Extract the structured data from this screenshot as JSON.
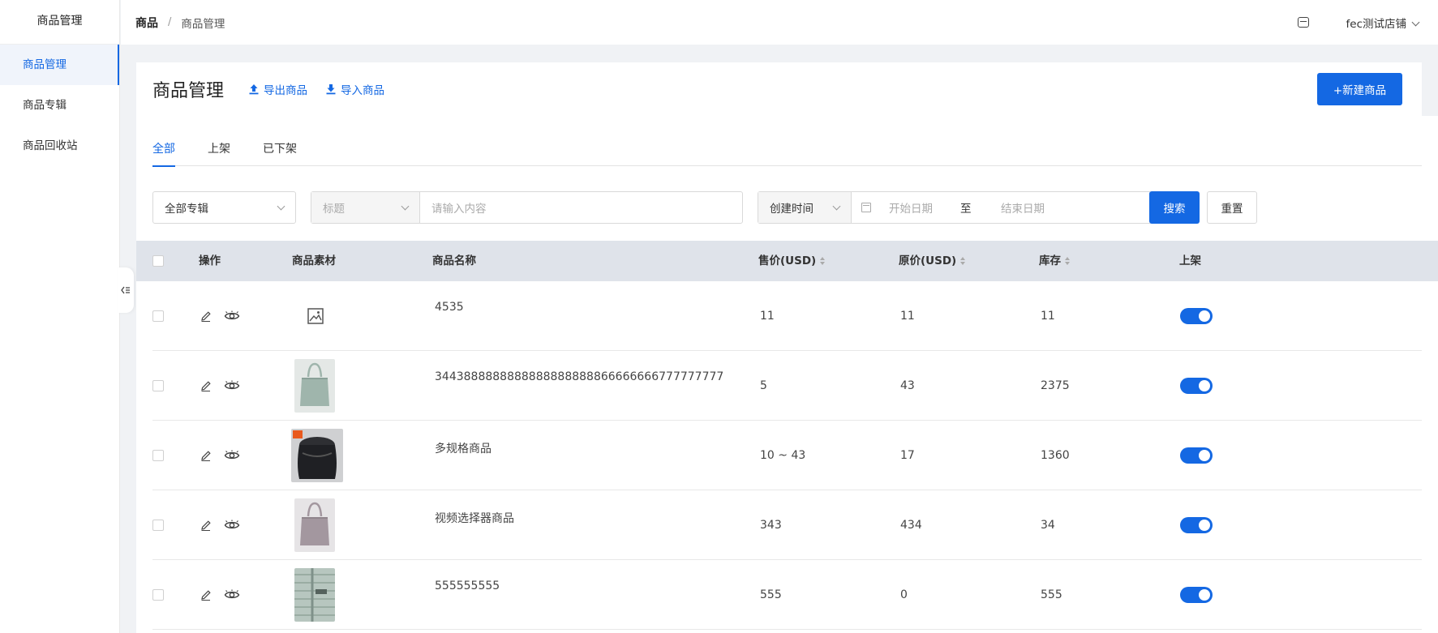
{
  "sidebar": {
    "title": "商品管理",
    "items": [
      {
        "label": "商品管理",
        "active": true
      },
      {
        "label": "商品专辑",
        "active": false
      },
      {
        "label": "商品回收站",
        "active": false
      }
    ]
  },
  "topbar": {
    "breadcrumb": [
      "商品",
      "商品管理"
    ],
    "separator": "/",
    "shop_name": "fec测试店铺"
  },
  "header": {
    "title": "商品管理",
    "export_label": "导出商品",
    "import_label": "导入商品",
    "new_button": "+新建商品"
  },
  "tabs": [
    {
      "label": "全部",
      "active": true
    },
    {
      "label": "上架",
      "active": false
    },
    {
      "label": "已下架",
      "active": false
    }
  ],
  "filters": {
    "album_select": "全部专辑",
    "field_select": "标题",
    "keyword_placeholder": "请输入内容",
    "time_select": "创建时间",
    "start_placeholder": "开始日期",
    "range_sep": "至",
    "end_placeholder": "结束日期",
    "search_button": "搜索",
    "reset_button": "重置"
  },
  "table": {
    "columns": [
      "操作",
      "商品素材",
      "商品名称",
      "售价(USD)",
      "原价(USD)",
      "库存",
      "上架"
    ],
    "rows": [
      {
        "image": "placeholder",
        "name": "4535",
        "price": "11",
        "original": "11",
        "stock": "11",
        "listed": true
      },
      {
        "image": "bag-green",
        "name": "3443888888888888888888866666666777777777",
        "price": "5",
        "original": "43",
        "stock": "2375",
        "listed": true
      },
      {
        "image": "bag-black",
        "name": "多规格商品",
        "price": "10 ~ 43",
        "original": "17",
        "stock": "1360",
        "listed": true
      },
      {
        "image": "bag-purple",
        "name": "视频选择器商品",
        "price": "343",
        "original": "434",
        "stock": "34",
        "listed": true
      },
      {
        "image": "jacket-green",
        "name": "555555555",
        "price": "555",
        "original": "0",
        "stock": "555",
        "listed": true
      }
    ]
  },
  "colors": {
    "accent": "#1468e3",
    "header_bg": "#dfe3ea",
    "page_bg": "#f0f2f5"
  }
}
